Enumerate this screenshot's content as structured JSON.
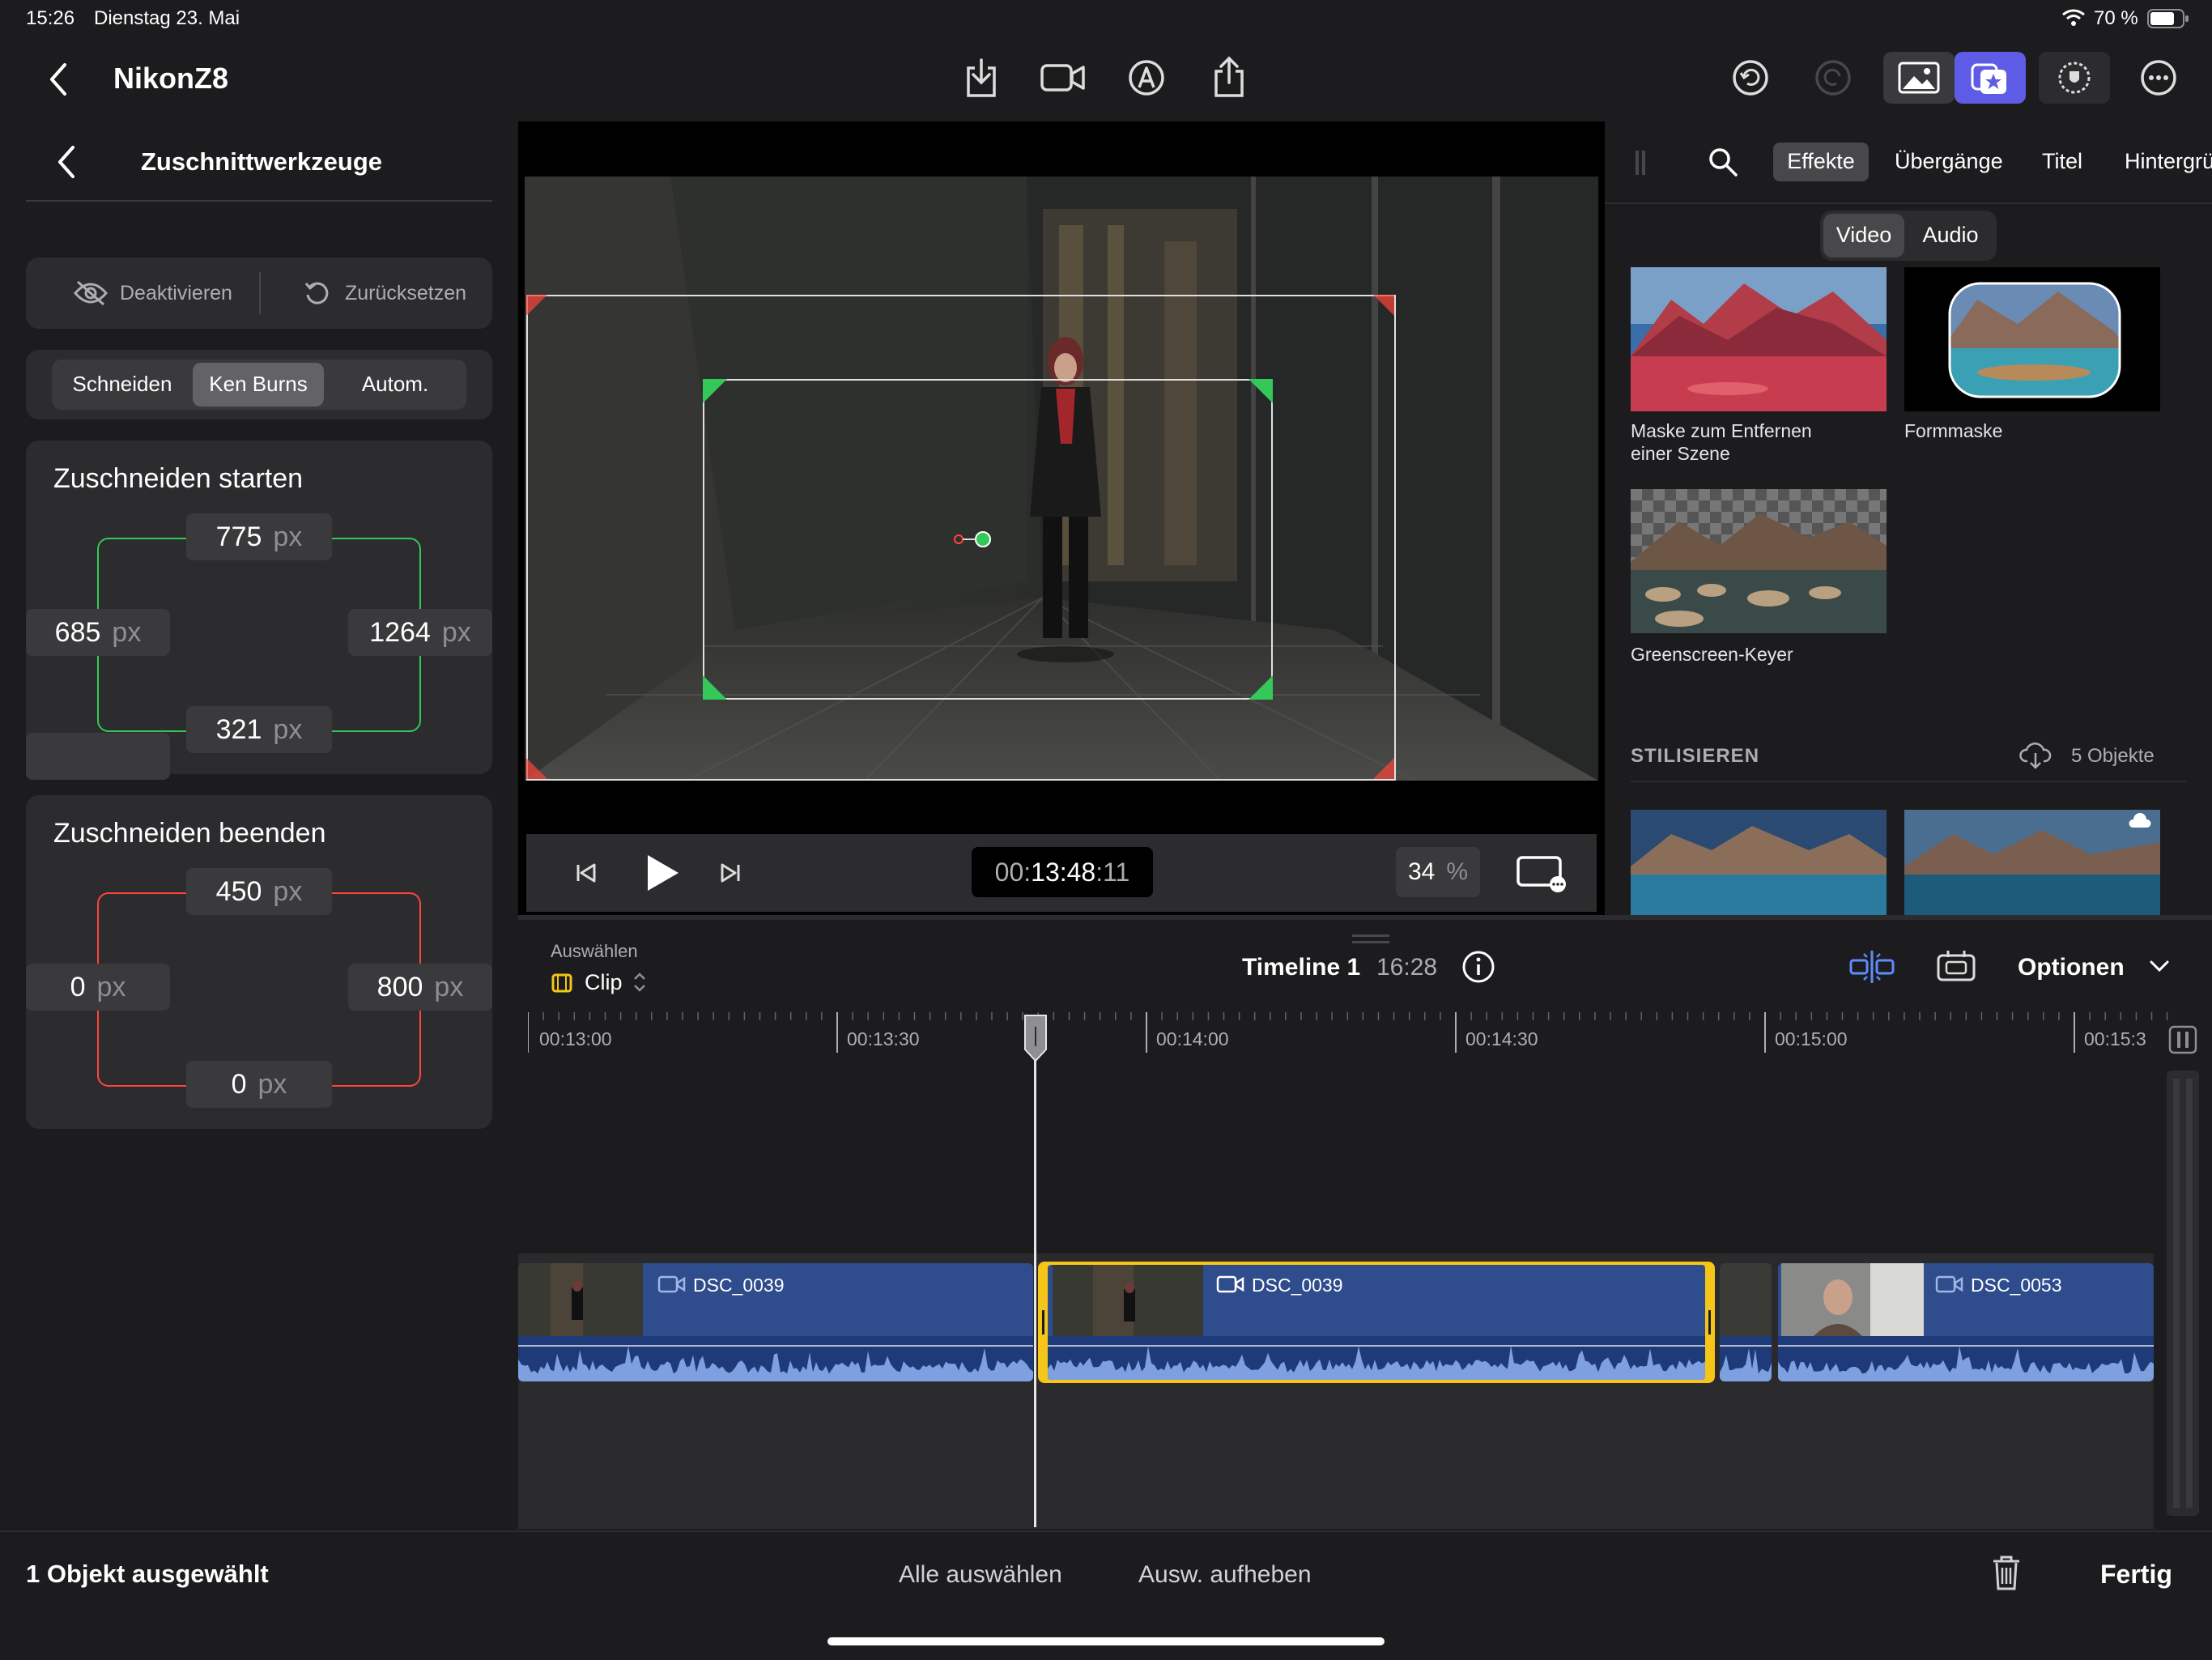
{
  "status": {
    "time": "15:26",
    "date": "Dienstag 23. Mai",
    "battery": "70 %"
  },
  "header": {
    "project_title": "NikonZ8"
  },
  "crop_panel": {
    "title": "Zuschnittwerkzeuge",
    "disable_label": "Deaktivieren",
    "reset_label": "Zurücksetzen",
    "modes": [
      "Schneiden",
      "Ken Burns",
      "Autom."
    ],
    "selected_mode": "Ken Burns",
    "start": {
      "title": "Zuschneiden starten",
      "top": "775",
      "left": "685",
      "right": "1264",
      "bottom": "321"
    },
    "end": {
      "title": "Zuschneiden beenden",
      "top": "450",
      "left": "0",
      "right": "800",
      "bottom": "0"
    },
    "unit": "px",
    "start_color": "#34c759",
    "end_color": "#ff453a"
  },
  "viewer": {
    "timecode_prefix": "00:",
    "timecode_main": "13:48",
    "timecode_suffix": ":11",
    "zoom_value": "34",
    "zoom_unit": "%"
  },
  "browser": {
    "tabs": [
      "Effekte",
      "Übergänge",
      "Titel",
      "Hintergrü"
    ],
    "selected_tab": "Effekte",
    "sub_tabs": [
      "Video",
      "Audio"
    ],
    "effects": [
      {
        "line1": "Maske zum Entfernen",
        "line2": "einer Szene"
      },
      {
        "line1": "Formmaske",
        "line2": ""
      },
      {
        "line1": "Greenscreen-Keyer",
        "line2": ""
      }
    ],
    "section_title": "STILISIEREN",
    "section_count": "5 Objekte"
  },
  "timeline": {
    "select_label": "Auswählen",
    "clip_label": "Clip",
    "name": "Timeline 1",
    "duration": "16:28",
    "options_label": "Optionen",
    "ruler": [
      "00:13:00",
      "00:13:30",
      "00:14:00",
      "00:14:30",
      "00:15:00",
      "00:15:3"
    ],
    "clips": [
      "DSC_0039",
      "DSC_0039",
      "DSC_0053"
    ],
    "accent": "#f5c518",
    "clip_color": "#2f4c8c"
  },
  "footer": {
    "selection_info": "1 Objekt ausgewählt",
    "select_all": "Alle auswählen",
    "deselect": "Ausw. aufheben",
    "done": "Fertig"
  }
}
